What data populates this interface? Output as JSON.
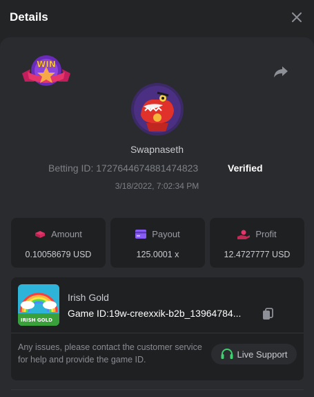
{
  "header": {
    "title": "Details"
  },
  "bet": {
    "username": "Swapnaseth",
    "betting_id_label": "Betting ID: 1727644674881474823",
    "verified": "Verified",
    "date": "3/18/2022, 7:02:34 PM"
  },
  "stats": [
    {
      "label": "Amount",
      "value": "0.10058679 USD",
      "icon": "chip-icon",
      "icon_color": "#e5356a"
    },
    {
      "label": "Payout",
      "value": "125.0001 x",
      "icon": "card-icon",
      "icon_color": "#8a5cf6"
    },
    {
      "label": "Profit",
      "value": "12.4727777 USD",
      "icon": "hand-coin-icon",
      "icon_color": "#e5356a"
    }
  ],
  "game": {
    "name": "Irish Gold",
    "id_label": "Game ID:19w-creexxik-b2b_13964784...",
    "thumb_title": "IRISH GOLD"
  },
  "support": {
    "message": "Any issues, please contact the customer service for help and provide the game ID.",
    "button_label": "Live Support",
    "icon_color": "#3fd16f"
  },
  "badge": {
    "text": "WIN"
  },
  "colors": {
    "background": "#232426",
    "panel": "#2a2b2e",
    "card": "#1f2022",
    "accent": "#e5356a"
  }
}
